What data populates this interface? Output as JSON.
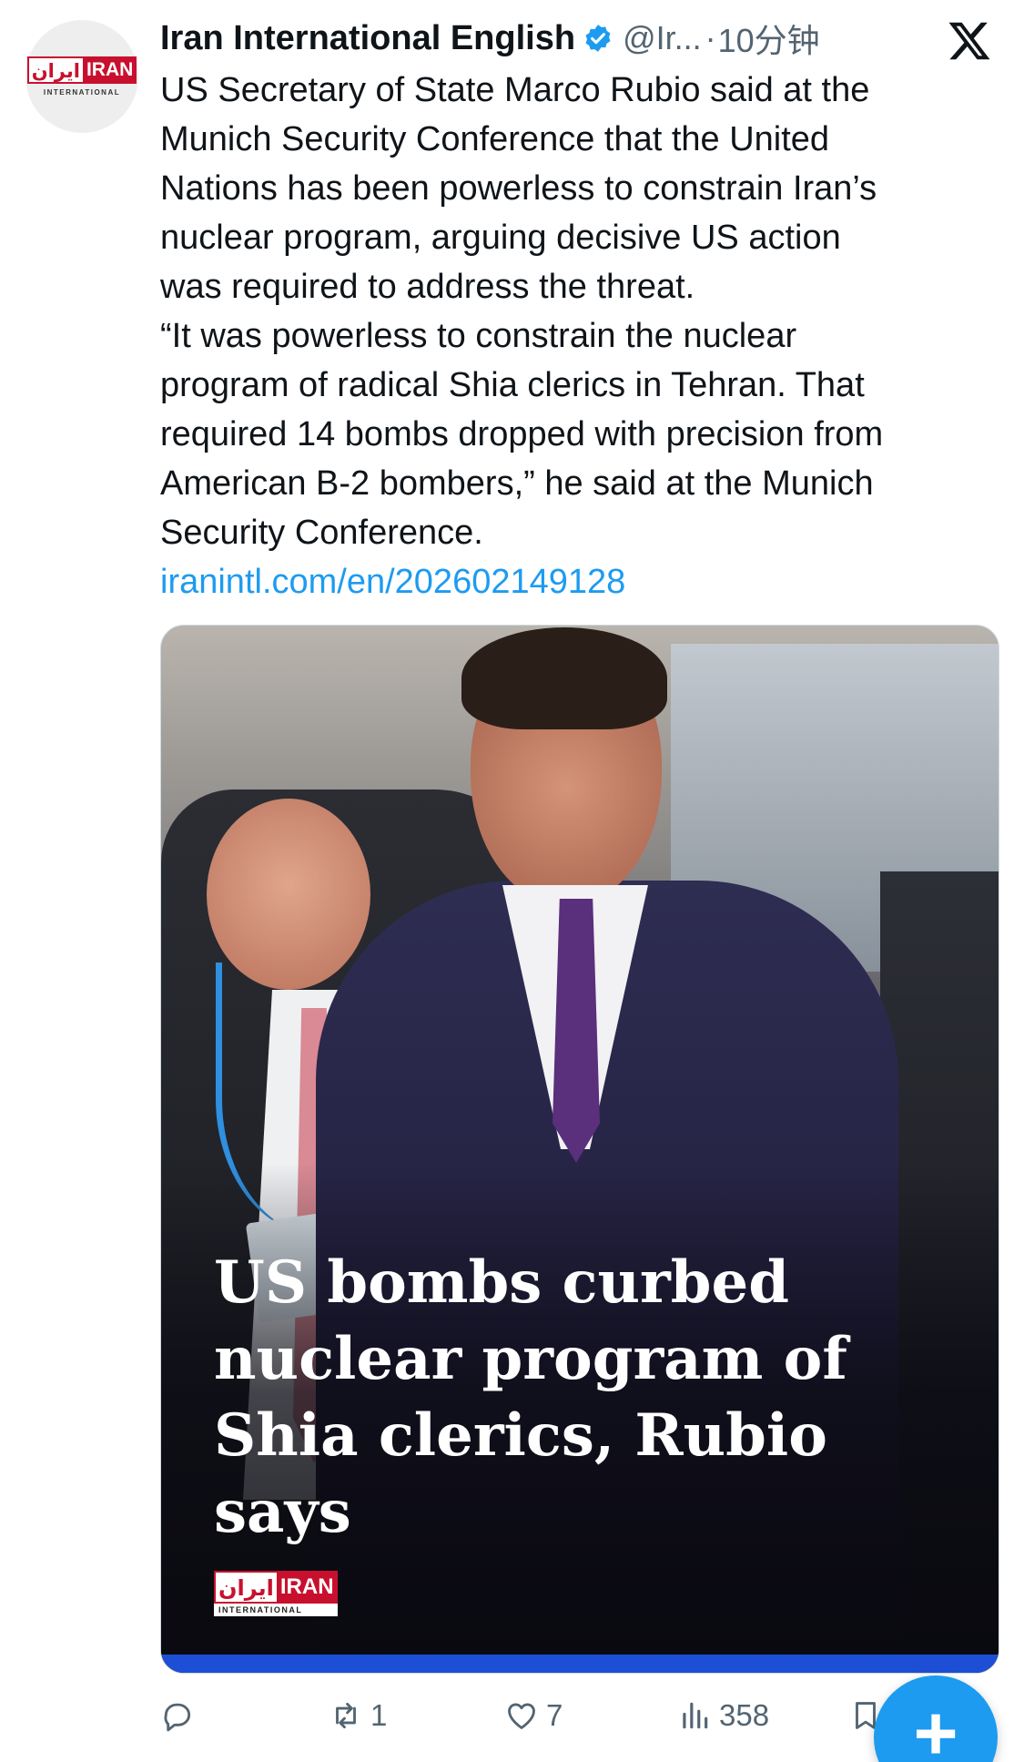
{
  "author": {
    "display_name": "Iran International English",
    "handle": "@Ir...",
    "separator": "·",
    "time": "10分钟",
    "avatar_logo_persian": "ایران",
    "avatar_logo_en": "IRAN",
    "avatar_logo_sub": "INTERNATIONAL"
  },
  "tweet": {
    "text": "US Secretary of State Marco Rubio said at the\nMunich Security Conference that the United\nNations has been powerless to constrain Iran’s\nnuclear program, arguing decisive US action\nwas required to address the threat.\n“It was powerless to constrain the nuclear\nprogram of radical Shia clerics in Tehran. That\nrequired 14 bombs dropped with precision from\nAmerican B-2 bombers,” he said at the Munich\nSecurity Conference.",
    "link": "iranintl.com/en/202602149128"
  },
  "media": {
    "headline": "US bombs curbed nuclear program of Shia clerics, Rubio says",
    "logo_persian": "ایران",
    "logo_en": "IRAN",
    "logo_sub": "INTERNATIONAL"
  },
  "actions": {
    "reply_count": "",
    "repost_count": "1",
    "like_count": "7",
    "views_count": "358"
  },
  "fab": {
    "label": "+"
  },
  "icons": {
    "verified": "verified-badge-icon",
    "x": "x-logo-icon",
    "reply": "reply-icon",
    "repost": "repost-icon",
    "like": "heart-icon",
    "views": "views-icon",
    "bookmark": "bookmark-icon"
  },
  "colors": {
    "link": "#1d9bf0",
    "secondary_text": "#536471",
    "brand_red": "#c8102e",
    "fab": "#1d9bf0"
  }
}
